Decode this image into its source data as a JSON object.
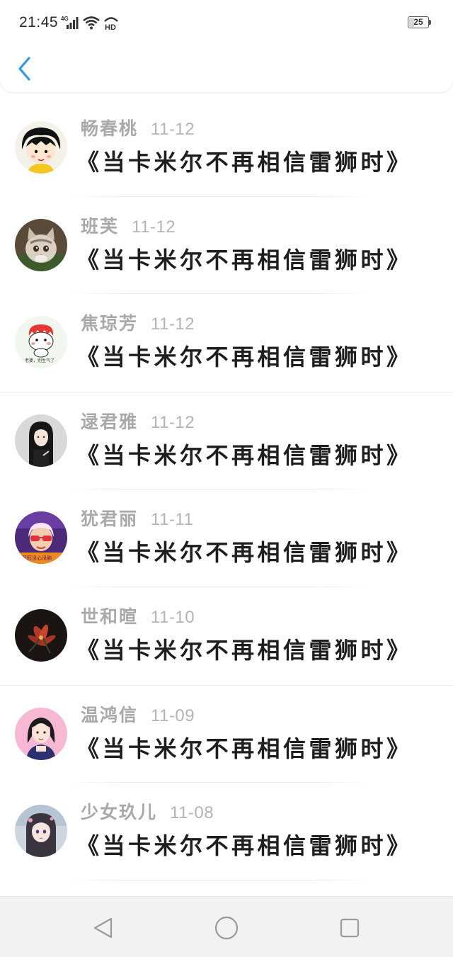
{
  "status_bar": {
    "time": "21:45",
    "network": "4G",
    "hd": "HD",
    "battery_level": "25",
    "battery_fraction": 0.25
  },
  "nav": {
    "back_icon": "chevron-left-icon",
    "accent_color": "#2f9be8"
  },
  "comments": [
    {
      "name": "畅春桃",
      "date": "11-12",
      "title": "《当卡米尔不再相信雷狮时》",
      "avatar": "cartoon-girl-avatar"
    },
    {
      "name": "班芙",
      "date": "11-12",
      "title": "《当卡米尔不再相信雷狮时》",
      "avatar": "kitten-avatar"
    },
    {
      "name": "焦琼芳",
      "date": "11-12",
      "title": "《当卡米尔不再相信雷狮时》",
      "avatar": "red-hair-cartoon-avatar"
    },
    {
      "name": "逯君雅",
      "date": "11-12",
      "title": "《当卡米尔不再相信雷狮时》",
      "avatar": "dark-hair-girl-avatar"
    },
    {
      "name": "犹君丽",
      "date": "11-11",
      "title": "《当卡米尔不再相信雷狮时》",
      "avatar": "sunglasses-avatar"
    },
    {
      "name": "世和暄",
      "date": "11-10",
      "title": "《当卡米尔不再相信雷狮时》",
      "avatar": "flower-avatar"
    },
    {
      "name": "温鸿信",
      "date": "11-09",
      "title": "《当卡米尔不再相信雷狮时》",
      "avatar": "pink-illustration-avatar"
    },
    {
      "name": "少女玖儿",
      "date": "11-08",
      "title": "《当卡米尔不再相信雷狮时》",
      "avatar": "anime-girl-avatar"
    }
  ],
  "system_nav": {
    "back_icon": "triangle-back-icon",
    "home_icon": "circle-home-icon",
    "recents_icon": "square-recents-icon"
  }
}
